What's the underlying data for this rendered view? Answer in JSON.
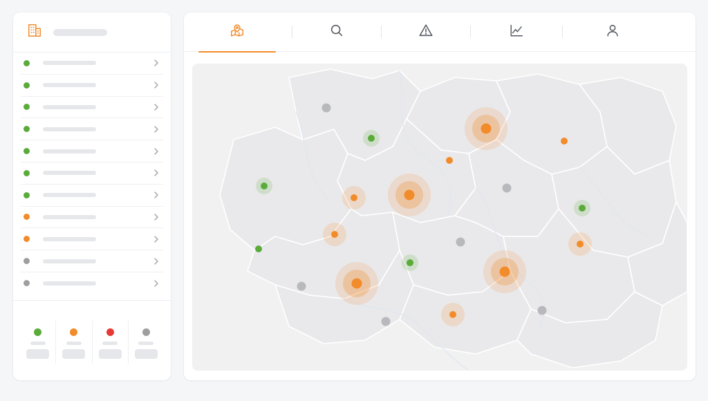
{
  "colors": {
    "accent": "#f28b2a",
    "green": "#5aab3a",
    "orange": "#f28b2a",
    "red": "#e53935",
    "gray": "#9e9e9e"
  },
  "sidebar": {
    "header_icon": "building-icon",
    "items": [
      {
        "status": "green"
      },
      {
        "status": "green"
      },
      {
        "status": "green"
      },
      {
        "status": "green"
      },
      {
        "status": "green"
      },
      {
        "status": "green"
      },
      {
        "status": "green"
      },
      {
        "status": "orange"
      },
      {
        "status": "orange"
      },
      {
        "status": "gray"
      },
      {
        "status": "gray"
      }
    ],
    "legend": [
      {
        "status": "green"
      },
      {
        "status": "orange"
      },
      {
        "status": "red"
      },
      {
        "status": "gray"
      }
    ]
  },
  "tabs": [
    {
      "icon": "map-pin-icon",
      "active": true
    },
    {
      "icon": "search-icon",
      "active": false
    },
    {
      "icon": "warning-icon",
      "active": false
    },
    {
      "icon": "chart-icon",
      "active": false
    },
    {
      "icon": "user-icon",
      "active": false
    }
  ],
  "map": {
    "markers": [
      {
        "status": "gray",
        "halo": "none"
      },
      {
        "status": "green",
        "halo": "small"
      },
      {
        "status": "orange",
        "halo": "large"
      },
      {
        "status": "orange",
        "halo": "none"
      },
      {
        "status": "orange",
        "halo": "none"
      },
      {
        "status": "green",
        "halo": "small"
      },
      {
        "status": "orange",
        "halo": "medium"
      },
      {
        "status": "orange",
        "halo": "large"
      },
      {
        "status": "gray",
        "halo": "none"
      },
      {
        "status": "green",
        "halo": "small"
      },
      {
        "status": "orange",
        "halo": "medium"
      },
      {
        "status": "green",
        "halo": "none"
      },
      {
        "status": "gray",
        "halo": "none"
      },
      {
        "status": "green",
        "halo": "small"
      },
      {
        "status": "orange",
        "halo": "medium"
      },
      {
        "status": "orange",
        "halo": "large"
      },
      {
        "status": "orange",
        "halo": "large"
      },
      {
        "status": "gray",
        "halo": "none"
      },
      {
        "status": "gray",
        "halo": "none"
      },
      {
        "status": "orange",
        "halo": "medium"
      },
      {
        "status": "gray",
        "halo": "none"
      }
    ]
  }
}
